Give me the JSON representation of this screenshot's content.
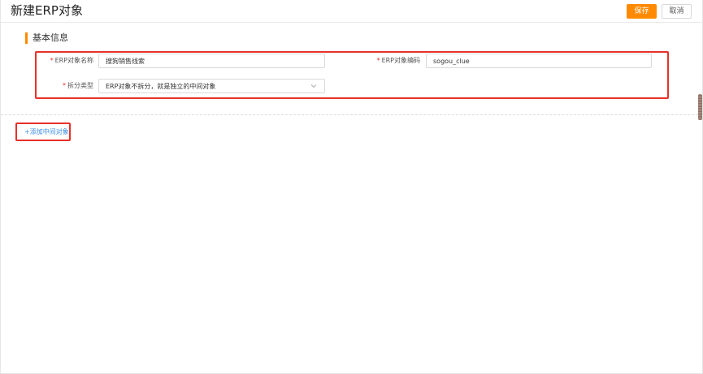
{
  "header": {
    "title": "新建ERP对象",
    "save_label": "保存",
    "cancel_label": "取消"
  },
  "section": {
    "title": "基本信息"
  },
  "form": {
    "required_mark": "*",
    "name_label": "ERP对象名称",
    "name_value": "搜狗销售线索",
    "code_label": "ERP对象编码",
    "code_value": "sogou_clue",
    "split_label": "拆分类型",
    "split_value": "ERP对象不拆分，就是独立的中间对象"
  },
  "actions": {
    "add_intermediate": "+添加中间对象"
  },
  "colors": {
    "accent": "#ff8a00",
    "highlight": "#e8302a",
    "link": "#3a8ee6"
  }
}
